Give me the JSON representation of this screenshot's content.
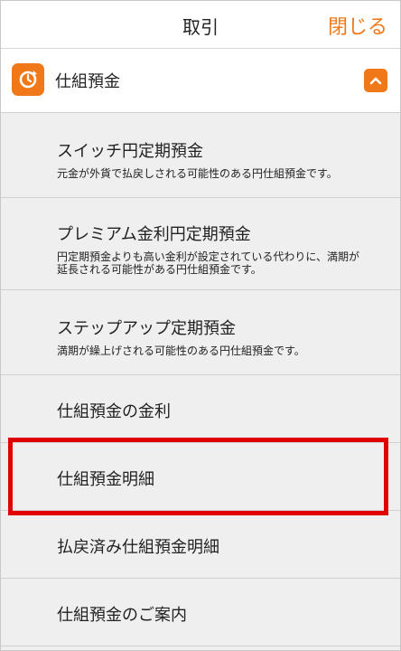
{
  "header": {
    "title": "取引",
    "close_label": "閉じる"
  },
  "section": {
    "title": "仕組預金"
  },
  "items": [
    {
      "label": "スイッチ円定期預金",
      "desc": "元金が外貨で払戻しされる可能性のある円仕組預金です。"
    },
    {
      "label": "プレミアム金利円定期預金",
      "desc": "円定期預金よりも高い金利が設定されている代わりに、満期が\n延長される可能性がある円仕組預金です。"
    },
    {
      "label": "ステップアップ定期預金",
      "desc": "満期が繰上げされる可能性のある円仕組預金です。"
    },
    {
      "label": "仕組預金の金利"
    },
    {
      "label": "仕組預金明細"
    },
    {
      "label": "払戻済み仕組預金明細"
    },
    {
      "label": "仕組預金のご案内"
    }
  ],
  "colors": {
    "accent": "#f07818",
    "highlight": "#e00000"
  },
  "icons": {
    "section": "clock-arrow-icon",
    "collapse": "chevron-up-icon"
  }
}
